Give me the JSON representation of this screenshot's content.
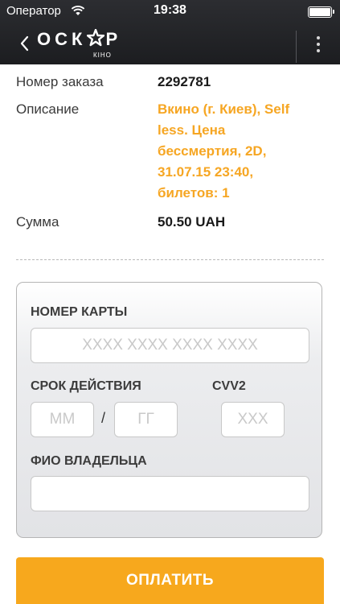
{
  "status_bar": {
    "carrier": "Оператор",
    "time": "19:38",
    "wifi_icon": "wifi-icon",
    "battery_icon": "battery-icon"
  },
  "navbar": {
    "back_icon": "chevron-left-icon",
    "logo_text_left": "ОСК",
    "logo_text_right": "Р",
    "logo_subtitle": "КІНО",
    "menu_icon": "vertical-dots-icon"
  },
  "order": {
    "number_label": "Номер заказа",
    "number_value": "2292781",
    "description_label": "Описание",
    "description_lines": [
      "Вкино (г. Киев), Self",
      "less. Цена",
      "бессмертия, 2D,",
      "31.07.15 23:40,",
      "билетов: 1"
    ],
    "sum_label": "Сумма",
    "sum_value": "50.50 UAH"
  },
  "card_form": {
    "card_number_label": "НОМЕР КАРТЫ",
    "card_number_placeholder": "XXXX XXXX XXXX XXXX",
    "card_number_value": "",
    "expiry_label": "СРОК ДЕЙСТВИЯ",
    "month_placeholder": "ММ",
    "month_value": "",
    "separator": "/",
    "year_placeholder": "ГГ",
    "year_value": "",
    "cvv_label": "CVV2",
    "cvv_placeholder": "XXX",
    "cvv_value": "",
    "holder_label": "ФИО ВЛАДЕЛЬЦА",
    "holder_placeholder": "",
    "holder_value": ""
  },
  "pay_button": {
    "label": "ОПЛАТИТЬ"
  },
  "colors": {
    "accent": "#f6a623",
    "pay_button": "#f7a81d",
    "header": "#232427"
  }
}
